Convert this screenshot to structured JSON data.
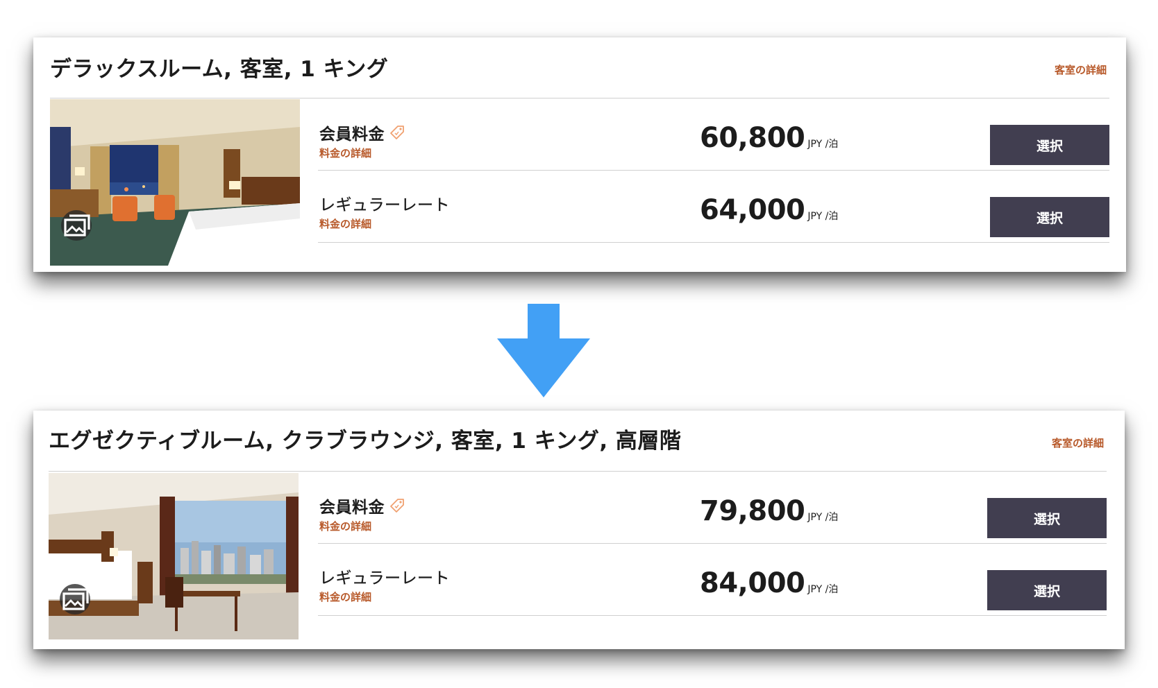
{
  "rooms": [
    {
      "title": "デラックスルーム, 客室, 1 キング",
      "details_link": "客室の詳細",
      "gallery_icon": "gallery-icon",
      "rates": [
        {
          "name": "会員料金",
          "tag_icon": "price-tag-icon",
          "details_link": "料金の詳細",
          "amount": "60,800",
          "unit": "JPY /泊",
          "button": "選択"
        },
        {
          "name": "レギュラーレート",
          "details_link": "料金の詳細",
          "amount": "64,000",
          "unit": "JPY /泊",
          "button": "選択"
        }
      ]
    },
    {
      "title": "エグゼクティブルーム, クラブラウンジ, 客室, 1 キング, 高層階",
      "details_link": "客室の詳細",
      "gallery_icon": "gallery-icon",
      "rates": [
        {
          "name": "会員料金",
          "tag_icon": "price-tag-icon",
          "details_link": "料金の詳細",
          "amount": "79,800",
          "unit": "JPY /泊",
          "button": "選択"
        },
        {
          "name": "レギュラーレート",
          "details_link": "料金の詳細",
          "amount": "84,000",
          "unit": "JPY /泊",
          "button": "選択"
        }
      ]
    }
  ],
  "arrow_icon": "down-arrow-icon",
  "colors": {
    "accent_link": "#b85a2b",
    "button_bg": "#413e50",
    "arrow": "#42a0f5",
    "tag_icon": "#f0a070"
  }
}
